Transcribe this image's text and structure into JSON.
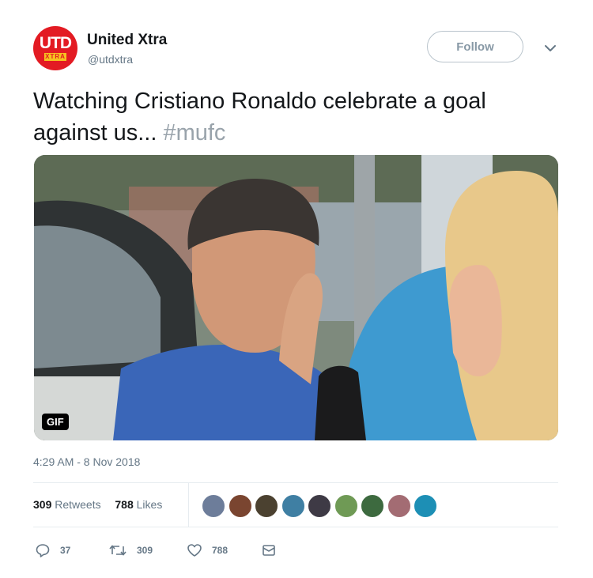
{
  "author": {
    "avatar_top": "UTD",
    "avatar_bottom": "XTRA",
    "name": "United Xtra",
    "handle": "@utdxtra"
  },
  "follow_label": "Follow",
  "tweet": {
    "text": "Watching Cristiano Ronaldo celebrate a goal against us...",
    "hashtag": "#mufc"
  },
  "media": {
    "badge": "GIF"
  },
  "timestamp": "4:29 AM - 8 Nov 2018",
  "stats": {
    "retweets_count": "309",
    "retweets_label": "Retweets",
    "likes_count": "788",
    "likes_label": "Likes"
  },
  "likers": [
    {
      "icon": "liker-avatar",
      "color": "#6d7d9a"
    },
    {
      "icon": "liker-avatar",
      "color": "#7a4530"
    },
    {
      "icon": "liker-avatar",
      "color": "#4b4130"
    },
    {
      "icon": "liker-avatar",
      "color": "#3f7fa3"
    },
    {
      "icon": "liker-avatar",
      "color": "#3e3a45"
    },
    {
      "icon": "liker-avatar",
      "color": "#6f9a55"
    },
    {
      "icon": "liker-avatar",
      "color": "#3d6a3f"
    },
    {
      "icon": "liker-avatar",
      "color": "#a36c73"
    },
    {
      "icon": "liker-avatar",
      "color": "#1d8fb5"
    }
  ],
  "actions": {
    "replies": "37",
    "retweets": "309",
    "likes": "788"
  },
  "colors": {
    "brand_red": "#e31b23",
    "brand_yellow": "#f6c220",
    "muted": "#657786",
    "hashtag": "#99a3ab"
  }
}
